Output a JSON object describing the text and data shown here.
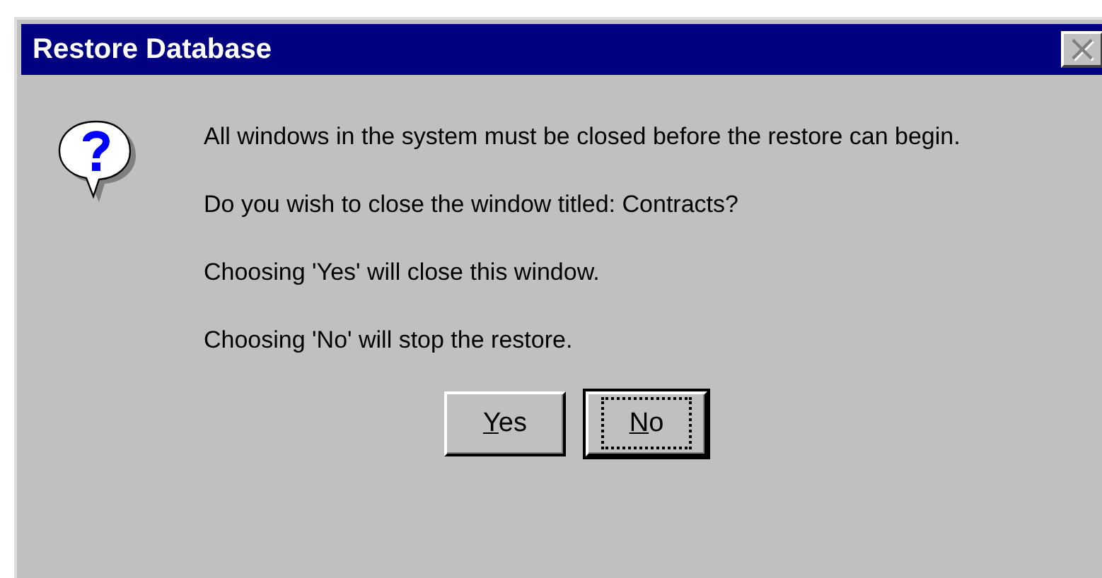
{
  "window": {
    "title": "Restore Database",
    "close_button": {
      "label": "×",
      "disabled": true
    }
  },
  "messages": [
    "All windows in the system must be closed before the restore can begin.",
    "Do you wish to close the window titled: Contracts?",
    "Choosing 'Yes' will close this window.",
    "Choosing 'No' will stop the restore."
  ],
  "buttons": [
    {
      "access_key": "Y",
      "rest": "es",
      "default": false
    },
    {
      "access_key": "N",
      "rest": "o",
      "default": true
    }
  ]
}
